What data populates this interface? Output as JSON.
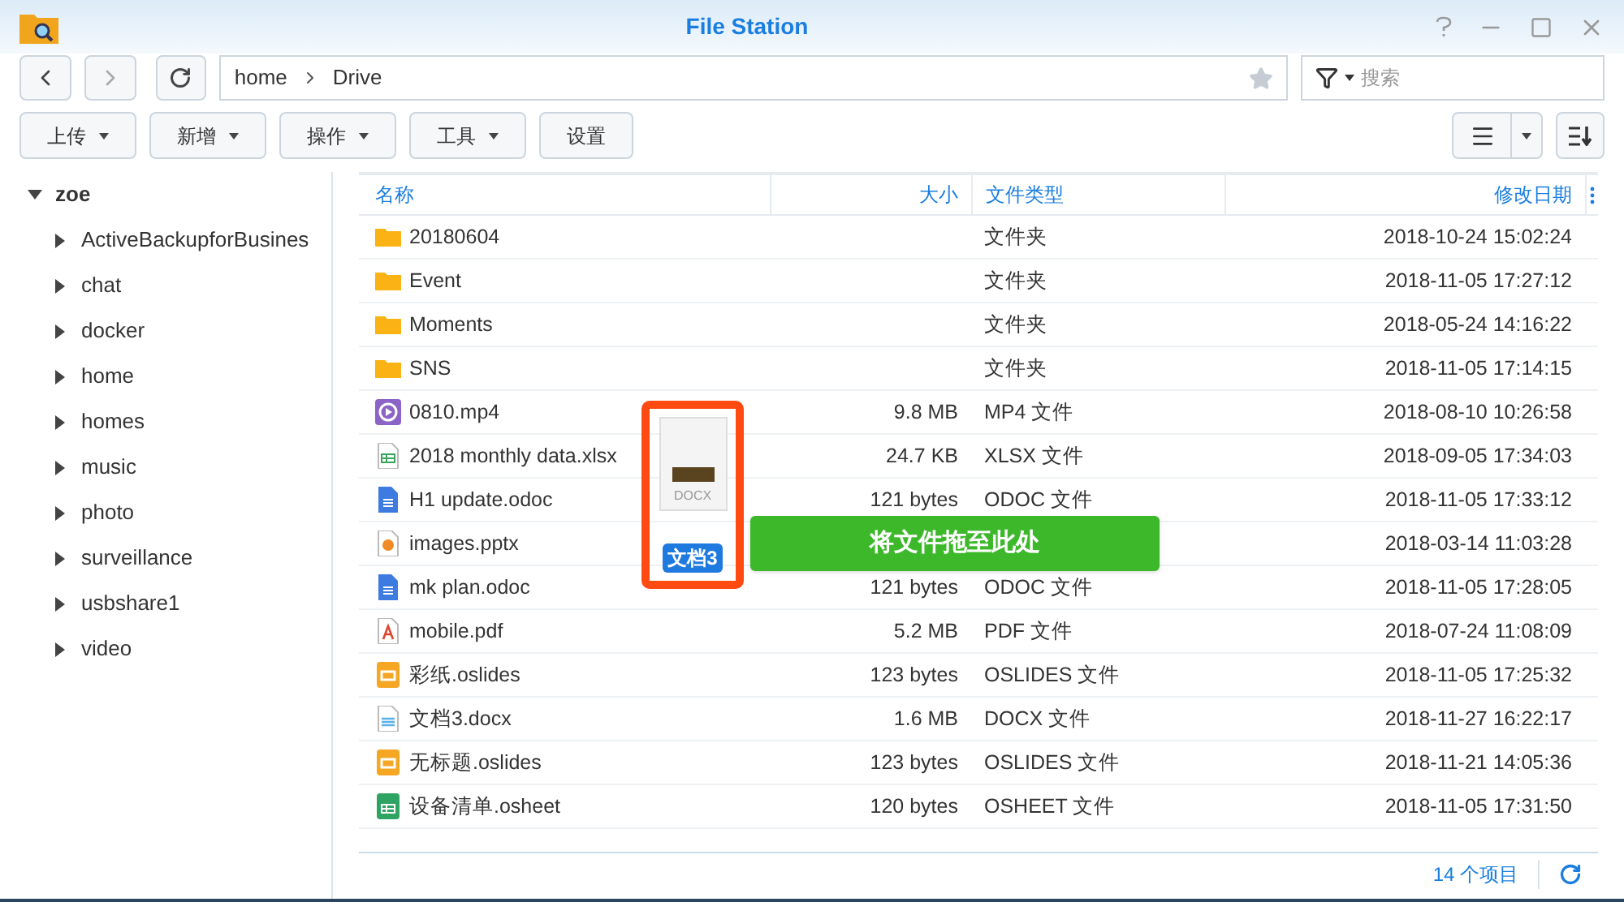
{
  "window": {
    "title": "File Station"
  },
  "nav": {
    "path": [
      "home",
      "Drive"
    ],
    "search_placeholder": "搜索"
  },
  "toolbar": [
    {
      "label": "上传",
      "kind": "menu"
    },
    {
      "label": "新增",
      "kind": "menu"
    },
    {
      "label": "操作",
      "kind": "menu"
    },
    {
      "label": "工具",
      "kind": "menu"
    },
    {
      "label": "设置",
      "kind": "plain"
    }
  ],
  "sidebar": {
    "root": {
      "label": "zoe",
      "expanded": true,
      "children": [
        {
          "label": "ActiveBackupforBusines",
          "expanded": false
        },
        {
          "label": "chat",
          "expanded": false
        },
        {
          "label": "docker",
          "expanded": false
        },
        {
          "label": "home",
          "expanded": false
        },
        {
          "label": "homes",
          "expanded": false
        },
        {
          "label": "music",
          "expanded": false
        },
        {
          "label": "photo",
          "expanded": false
        },
        {
          "label": "surveillance",
          "expanded": false
        },
        {
          "label": "usbshare1",
          "expanded": false
        },
        {
          "label": "video",
          "expanded": false
        }
      ]
    }
  },
  "table": {
    "columns": [
      "名称",
      "大小",
      "文件类型",
      "修改日期"
    ],
    "rows": [
      {
        "kind": "folder",
        "name": "20180604",
        "type": "文件夹",
        "modified": "2018-10-24 15:02:24"
      },
      {
        "kind": "folder",
        "name": "Event",
        "type": "文件夹",
        "modified": "2018-11-05 17:27:12"
      },
      {
        "kind": "folder",
        "name": "Moments",
        "type": "文件夹",
        "modified": "2018-05-24 14:16:22"
      },
      {
        "kind": "folder",
        "name": "SNS",
        "type": "文件夹",
        "modified": "2018-11-05 17:14:15"
      },
      {
        "kind": "video",
        "name": "0810.mp4",
        "size": "9.8 MB",
        "type": "MP4 文件",
        "modified": "2018-08-10 10:26:58"
      },
      {
        "kind": "spreadsheet",
        "name": "2018 monthly data.xlsx",
        "size": "24.7 KB",
        "type": "XLSX 文件",
        "modified": "2018-09-05 17:34:03"
      },
      {
        "kind": "document",
        "name": "H1 update.odoc",
        "size": "121 bytes",
        "type": "ODOC 文件",
        "modified": "2018-11-05 17:33:12"
      },
      {
        "kind": "presentation",
        "name": "images.pptx",
        "modified": "2018-03-14 11:03:28"
      },
      {
        "kind": "document",
        "name": "mk plan.odoc",
        "size": "121 bytes",
        "type": "ODOC 文件",
        "modified": "2018-11-05 17:28:05"
      },
      {
        "kind": "pdf",
        "name": "mobile.pdf",
        "size": "5.2 MB",
        "type": "PDF 文件",
        "modified": "2018-07-24 11:08:09"
      },
      {
        "kind": "slides",
        "name": "彩纸.oslides",
        "size": "123 bytes",
        "type": "OSLIDES 文件",
        "modified": "2018-11-05 17:25:32"
      },
      {
        "kind": "word",
        "name": "文档3.docx",
        "size": "1.6 MB",
        "type": "DOCX 文件",
        "modified": "2018-11-27 16:22:17"
      },
      {
        "kind": "slides",
        "name": "无标题.oslides",
        "size": "123 bytes",
        "type": "OSLIDES 文件",
        "modified": "2018-11-21 14:05:36"
      },
      {
        "kind": "sheet",
        "name": "设备清单.osheet",
        "size": "120 bytes",
        "type": "OSHEET 文件",
        "modified": "2018-11-05 17:31:50"
      }
    ]
  },
  "drag": {
    "icon_label": "DOCX",
    "file_label": "文档3",
    "drop_hint": "将文件拖至此处"
  },
  "footer": {
    "count": "14 个项目"
  }
}
